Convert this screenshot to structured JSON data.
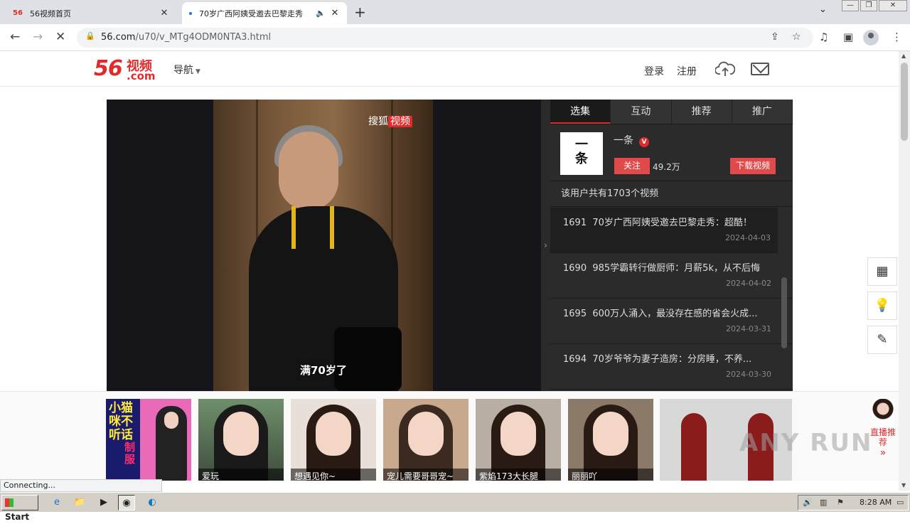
{
  "browser": {
    "tabs": [
      {
        "title": "56视频首页",
        "favicon": "56"
      },
      {
        "title": "70岁广西阿姨受邀去巴黎走秀"
      }
    ],
    "url_host": "56.com",
    "url_path": "/u70/v_MTg4ODM0NTA3.html",
    "status": "Connecting..."
  },
  "site": {
    "logo_num": "56",
    "logo_cn": "视频",
    "logo_com": ".com",
    "nav": "导航",
    "login": "登录",
    "register": "注册"
  },
  "player": {
    "watermark_a": "搜狐",
    "watermark_b": "视频",
    "subtitle": "满70岁了"
  },
  "panel": {
    "tabs": [
      "选集",
      "互动",
      "推荐",
      "推广"
    ],
    "author_avatar": "一条",
    "author_name": "一条",
    "verified": "V",
    "follow": "关注",
    "followers": "49.2万",
    "download": "下载视频",
    "count_text": "该用户共有1703个视频",
    "episodes": [
      {
        "num": "1691",
        "title": "70岁广西阿姨受邀去巴黎走秀：超酷！",
        "date": "2024-04-03"
      },
      {
        "num": "1690",
        "title": "985学霸转行做厨师：月薪5k，从不后悔",
        "date": "2024-04-02"
      },
      {
        "num": "1695",
        "title": "600万人涌入，最没存在感的省会火成...",
        "date": "2024-03-31"
      },
      {
        "num": "1694",
        "title": "70岁爷爷为妻子造房：分房睡，不养...",
        "date": "2024-03-30"
      }
    ]
  },
  "ads": {
    "first_vertical": "小猫咪不听话",
    "first_side": "制服",
    "captions": [
      "爱玩",
      "想遇见你~",
      "宠儿需要哥哥宠~",
      "紫焰173大长腿",
      "丽丽吖",
      ""
    ],
    "live_label": "直播推荐"
  },
  "watermark": "ANY RUN",
  "taskbar": {
    "start": "Start",
    "clock": "8:28 AM"
  }
}
